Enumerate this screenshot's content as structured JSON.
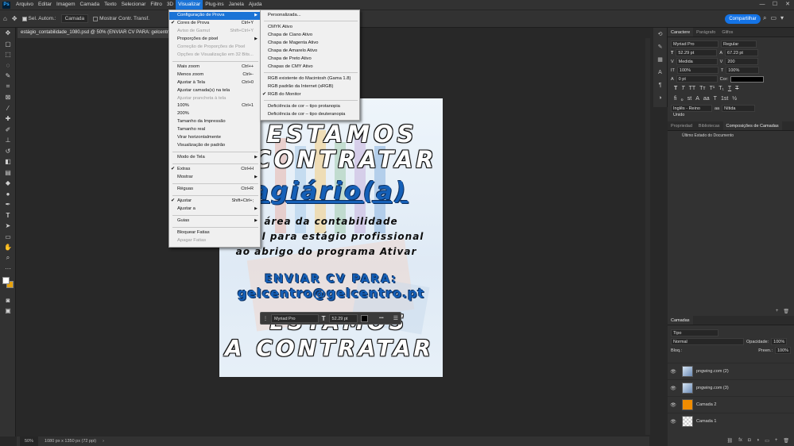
{
  "menubar": {
    "items": [
      "Arquivo",
      "Editar",
      "Imagem",
      "Camada",
      "Texto",
      "Selecionar",
      "Filtro",
      "3D",
      "Visualizar",
      "Plug-ins",
      "Janela",
      "Ajuda"
    ],
    "active_index": 8
  },
  "optionsbar": {
    "auto_select_label": "Sel. Autom.:",
    "auto_select_value": "Camada",
    "transform_label": "Mostrar Contr. Transf."
  },
  "share_button": "Compartilhar",
  "doc_tab": "estágio_contabilidade_1080.psd @ 50% (ENVIAR CV PARA: gelcentro",
  "view_menu": [
    {
      "label": "Configuração de Prova",
      "highlight": true,
      "submenu": true
    },
    {
      "label": "Cores de Prova",
      "shortcut": "Ctrl+Y",
      "checked": true
    },
    {
      "label": "Aviso de Gamut",
      "shortcut": "Shift+Ctrl+Y",
      "disabled": true
    },
    {
      "label": "Proporções de pixel",
      "submenu": true
    },
    {
      "label": "Correção de Proporções de Pixel",
      "disabled": true
    },
    {
      "label": "Opções de Visualização em 32 Bits...",
      "disabled": true
    },
    {
      "sep": true
    },
    {
      "label": "Mais zoom",
      "shortcut": "Ctrl++"
    },
    {
      "label": "Menos zoom",
      "shortcut": "Ctrl+-"
    },
    {
      "label": "Ajustar à Tela",
      "shortcut": "Ctrl+0"
    },
    {
      "label": "Ajustar camada(s) na tela"
    },
    {
      "label": "Ajustar prancheta à tela",
      "disabled": true
    },
    {
      "label": "100%",
      "shortcut": "Ctrl+1"
    },
    {
      "label": "200%"
    },
    {
      "label": "Tamanho da Impressão"
    },
    {
      "label": "Tamanho real"
    },
    {
      "label": "Virar horizontalmente"
    },
    {
      "label": "Visualização de padrão"
    },
    {
      "sep": true
    },
    {
      "label": "Modo de Tela",
      "submenu": true
    },
    {
      "sep": true
    },
    {
      "label": "Extras",
      "shortcut": "Ctrl+H",
      "checked": true
    },
    {
      "label": "Mostrar",
      "submenu": true
    },
    {
      "sep": true
    },
    {
      "label": "Réguas",
      "shortcut": "Ctrl+R"
    },
    {
      "sep": true
    },
    {
      "label": "Ajustar",
      "shortcut": "Shift+Ctrl+;",
      "checked": true
    },
    {
      "label": "Ajustar a",
      "submenu": true
    },
    {
      "sep": true
    },
    {
      "label": "Guias",
      "submenu": true
    },
    {
      "sep": true
    },
    {
      "label": "Bloquear Fatias"
    },
    {
      "label": "Apagar Fatias",
      "disabled": true
    }
  ],
  "proof_submenu": [
    {
      "label": "Personalizada..."
    },
    {
      "sep": true
    },
    {
      "label": "CMYK Ativo"
    },
    {
      "label": "Chapa de Ciano Ativo"
    },
    {
      "label": "Chapa de Magenta Ativo"
    },
    {
      "label": "Chapa de Amarelo Ativo"
    },
    {
      "label": "Chapa de Preto Ativo"
    },
    {
      "label": "Chapas de CMY Ativo"
    },
    {
      "sep": true
    },
    {
      "label": "RGB existente do Macintosh (Gama 1.8)"
    },
    {
      "label": "RGB padrão da Internet (sRGB)"
    },
    {
      "label": "RGB do Monitor",
      "checked": true
    },
    {
      "sep": true
    },
    {
      "label": "Deficiência de cor – tipo protanopia"
    },
    {
      "label": "Deficiência de cor – tipo deuteranopia"
    }
  ],
  "poster": {
    "line1": "ESTAMOS",
    "line2": "CONTRATAR",
    "line3": "stagiário(a)",
    "line4": "área da contabilidade",
    "line5": "vel para estágio profissional",
    "line6": "ao abrigo do programa Ativar",
    "line7": "ENVIAR CV PARA:",
    "line8": "gelcentro@gelcentro.pt",
    "line9": "ESTAMOS",
    "line10": "A CONTRATAR"
  },
  "textbar": {
    "font": "Myriad Pro",
    "size": "52.29 pt",
    "more": "•••"
  },
  "statusbar": {
    "zoom": "50%",
    "info": "1080 px x 1350 px (72 ppi)"
  },
  "character_panel": {
    "tabs": [
      "Caractere",
      "Parágrafo",
      "Glifos"
    ],
    "font_family": "Myriad Pro",
    "font_style": "Regular",
    "font_size": "52.29 pt",
    "leading": "67.23 pt",
    "kerning": "Medida",
    "tracking": "200",
    "vscale": "100%",
    "hscale": "100%",
    "baseline": "0 pt",
    "color_label": "Cor:",
    "language": "Inglês - Reino Unido",
    "antialias": "Nítida"
  },
  "comp_panel": {
    "tabs": [
      "Propriedad",
      "Bibliotecas",
      "Composições de Camadas"
    ],
    "item": "Último Estado do Documento"
  },
  "layers_panel": {
    "tab": "Camadas",
    "kind": "Tipo",
    "blend": "Normal",
    "opacity_label": "Opacidade:",
    "opacity": "100%",
    "lock_label": "Bloq.:",
    "fill_label": "Preen.:",
    "fill": "100%",
    "layers": [
      {
        "name": "pngwing.com (2)",
        "thumb": "img"
      },
      {
        "name": "pngwing.com (3)",
        "thumb": "img"
      },
      {
        "name": "Camada 2",
        "thumb": "orange"
      },
      {
        "name": "Camada 1",
        "thumb": "checker"
      }
    ]
  },
  "colors": {
    "accent": "#1473e6",
    "menu_highlight": "#1a73d6",
    "background_swatch": "#e6a20e",
    "poster_blue": "#1560b8"
  }
}
